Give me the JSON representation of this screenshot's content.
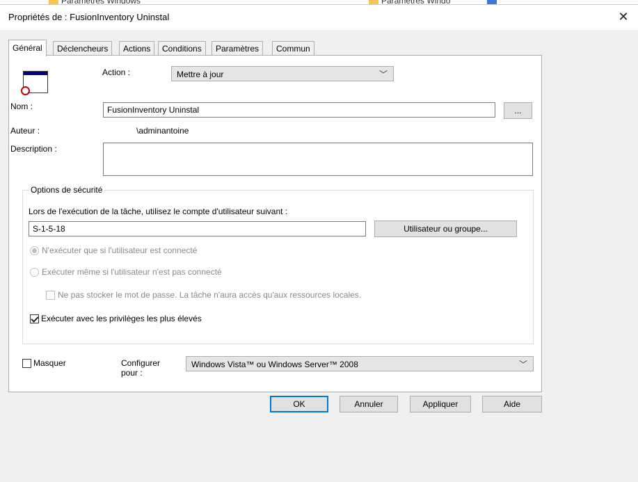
{
  "background": {
    "left_item": "Paramètres Windows",
    "right_item": "Paramètres Windo"
  },
  "window": {
    "title": "Propriétés de : FusionInventory Uninstal",
    "close_glyph": "✕"
  },
  "tabs": [
    {
      "label": "Général",
      "active": true
    },
    {
      "label": "Déclencheurs",
      "active": false
    },
    {
      "label": "Actions",
      "active": false
    },
    {
      "label": "Conditions",
      "active": false
    },
    {
      "label": "Paramètres",
      "active": false
    },
    {
      "label": "Commun",
      "active": false
    }
  ],
  "general": {
    "action_label": "Action :",
    "action_value": "Mettre à jour",
    "name_label": "Nom :",
    "name_value": "FusionInventory Uninstal",
    "browse_label": "...",
    "author_label": "Auteur :",
    "author_value": "\\adminantoine",
    "description_label": "Description :",
    "description_value": ""
  },
  "security": {
    "legend": "Options de sécurité",
    "account_prompt": "Lors de l'exécution de la tâche, utilisez le compte d'utilisateur suivant :",
    "account_value": "S-1-5-18",
    "user_group_button": "Utilisateur ou groupe...",
    "radio_logged_on": "N'exécuter que si l'utilisateur est connecté",
    "radio_any": "Exécuter même si l'utilisateur n'est pas connecté",
    "no_store_password": "Ne pas stocker le mot de passe. La tâche n'aura accès qu'aux ressources locales.",
    "highest_privileges": "Exécuter avec les privilèges les plus élevés"
  },
  "bottom": {
    "hidden_label": "Masquer",
    "configure_label_1": "Configurer",
    "configure_label_2": "pour :",
    "configure_value": "Windows Vista™ ou Windows Server™ 2008"
  },
  "buttons": {
    "ok": "OK",
    "cancel": "Annuler",
    "apply": "Appliquer",
    "help": "Aide"
  },
  "icons": {
    "chevron": "﹀"
  }
}
